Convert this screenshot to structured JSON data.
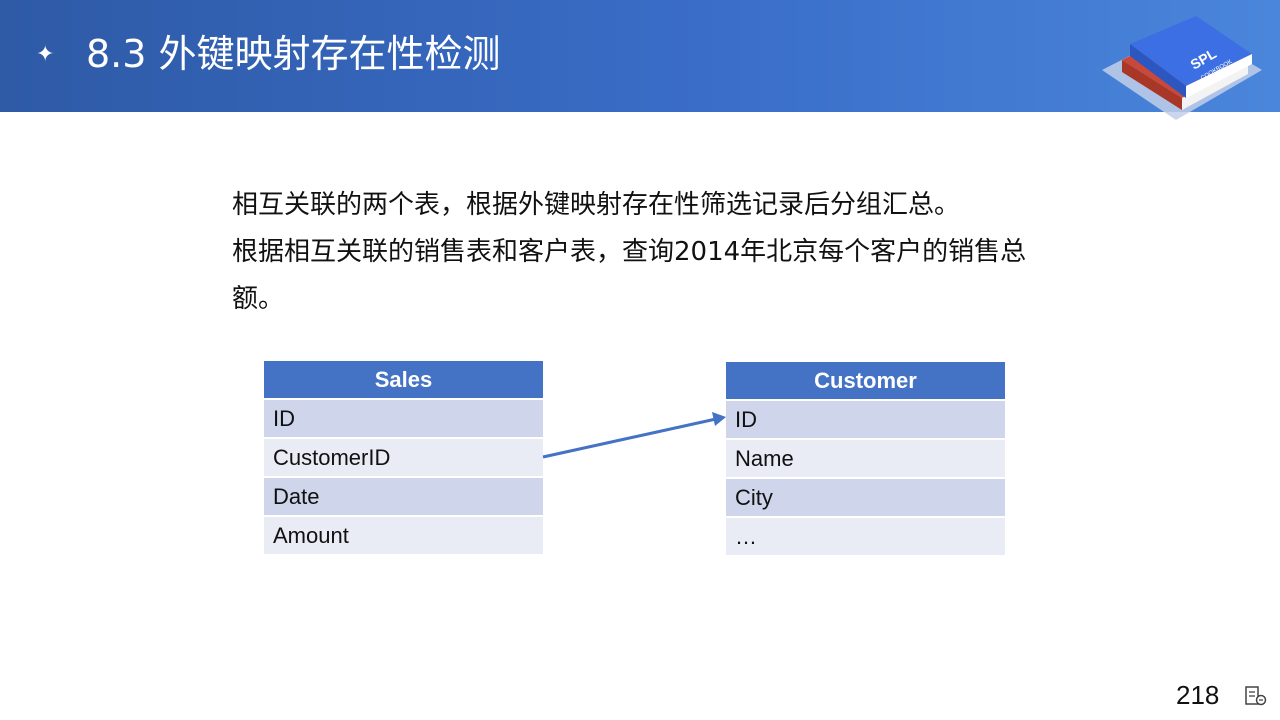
{
  "header": {
    "bullet_glyph": "✦",
    "title": "8.3 外键映射存在性检测",
    "logo": {
      "text": "SPL",
      "subtext": "COOKBOOK",
      "colors": {
        "top": "#3a6fe0",
        "middle": "#d9533a",
        "base": "#b9c7e8"
      }
    },
    "colors": {
      "from": "#2e5aa6",
      "to": "#4a86db"
    }
  },
  "description": {
    "line1": "相互关联的两个表，根据外键映射存在性筛选记录后分组汇总。",
    "line2": "根据相互关联的销售表和客户表，查询2014年北京每个客户的销售总额。"
  },
  "tables": {
    "sales": {
      "header": "Sales",
      "fields": [
        "ID",
        "CustomerID",
        "Date",
        "Amount"
      ]
    },
    "customer": {
      "header": "Customer",
      "fields": [
        "ID",
        "Name",
        "City",
        "…"
      ]
    }
  },
  "relation": {
    "from": "Sales.CustomerID",
    "to": "Customer.ID",
    "color": "#4472c4"
  },
  "footer": {
    "page_number": "218",
    "icon": "notes-icon"
  }
}
